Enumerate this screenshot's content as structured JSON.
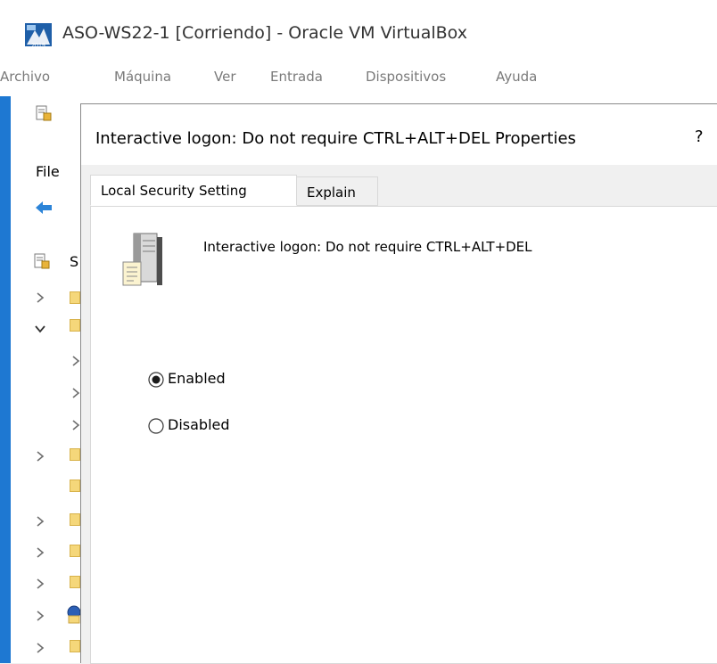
{
  "host_window": {
    "title": "ASO-WS22-1 [Corriendo] - Oracle VM VirtualBox",
    "icon": "virtualbox-app-icon",
    "menu": [
      "Archivo",
      "Máquina",
      "Ver",
      "Entrada",
      "Dispositivos",
      "Ayuda"
    ]
  },
  "background_window": {
    "menu_first": "File",
    "tree_root_label": "S",
    "icons": [
      "security-policy-icon",
      "back-arrow-icon",
      "folder-icon",
      "chevron-right-icon",
      "chevron-down-icon"
    ]
  },
  "dialog": {
    "title": "Interactive logon: Do not require CTRL+ALT+DEL Properties",
    "help": "?",
    "tabs": [
      {
        "label": "Local Security Setting",
        "active": true
      },
      {
        "label": "Explain",
        "active": false
      }
    ],
    "setting_name": "Interactive logon: Do not require CTRL+ALT+DEL",
    "options": [
      {
        "label": "Enabled",
        "selected": true
      },
      {
        "label": "Disabled",
        "selected": false
      }
    ]
  },
  "colors": {
    "guest_border": "#1e78d2",
    "panel_bg": "#f0f0f0",
    "menu_text": "#7a7a7a"
  }
}
